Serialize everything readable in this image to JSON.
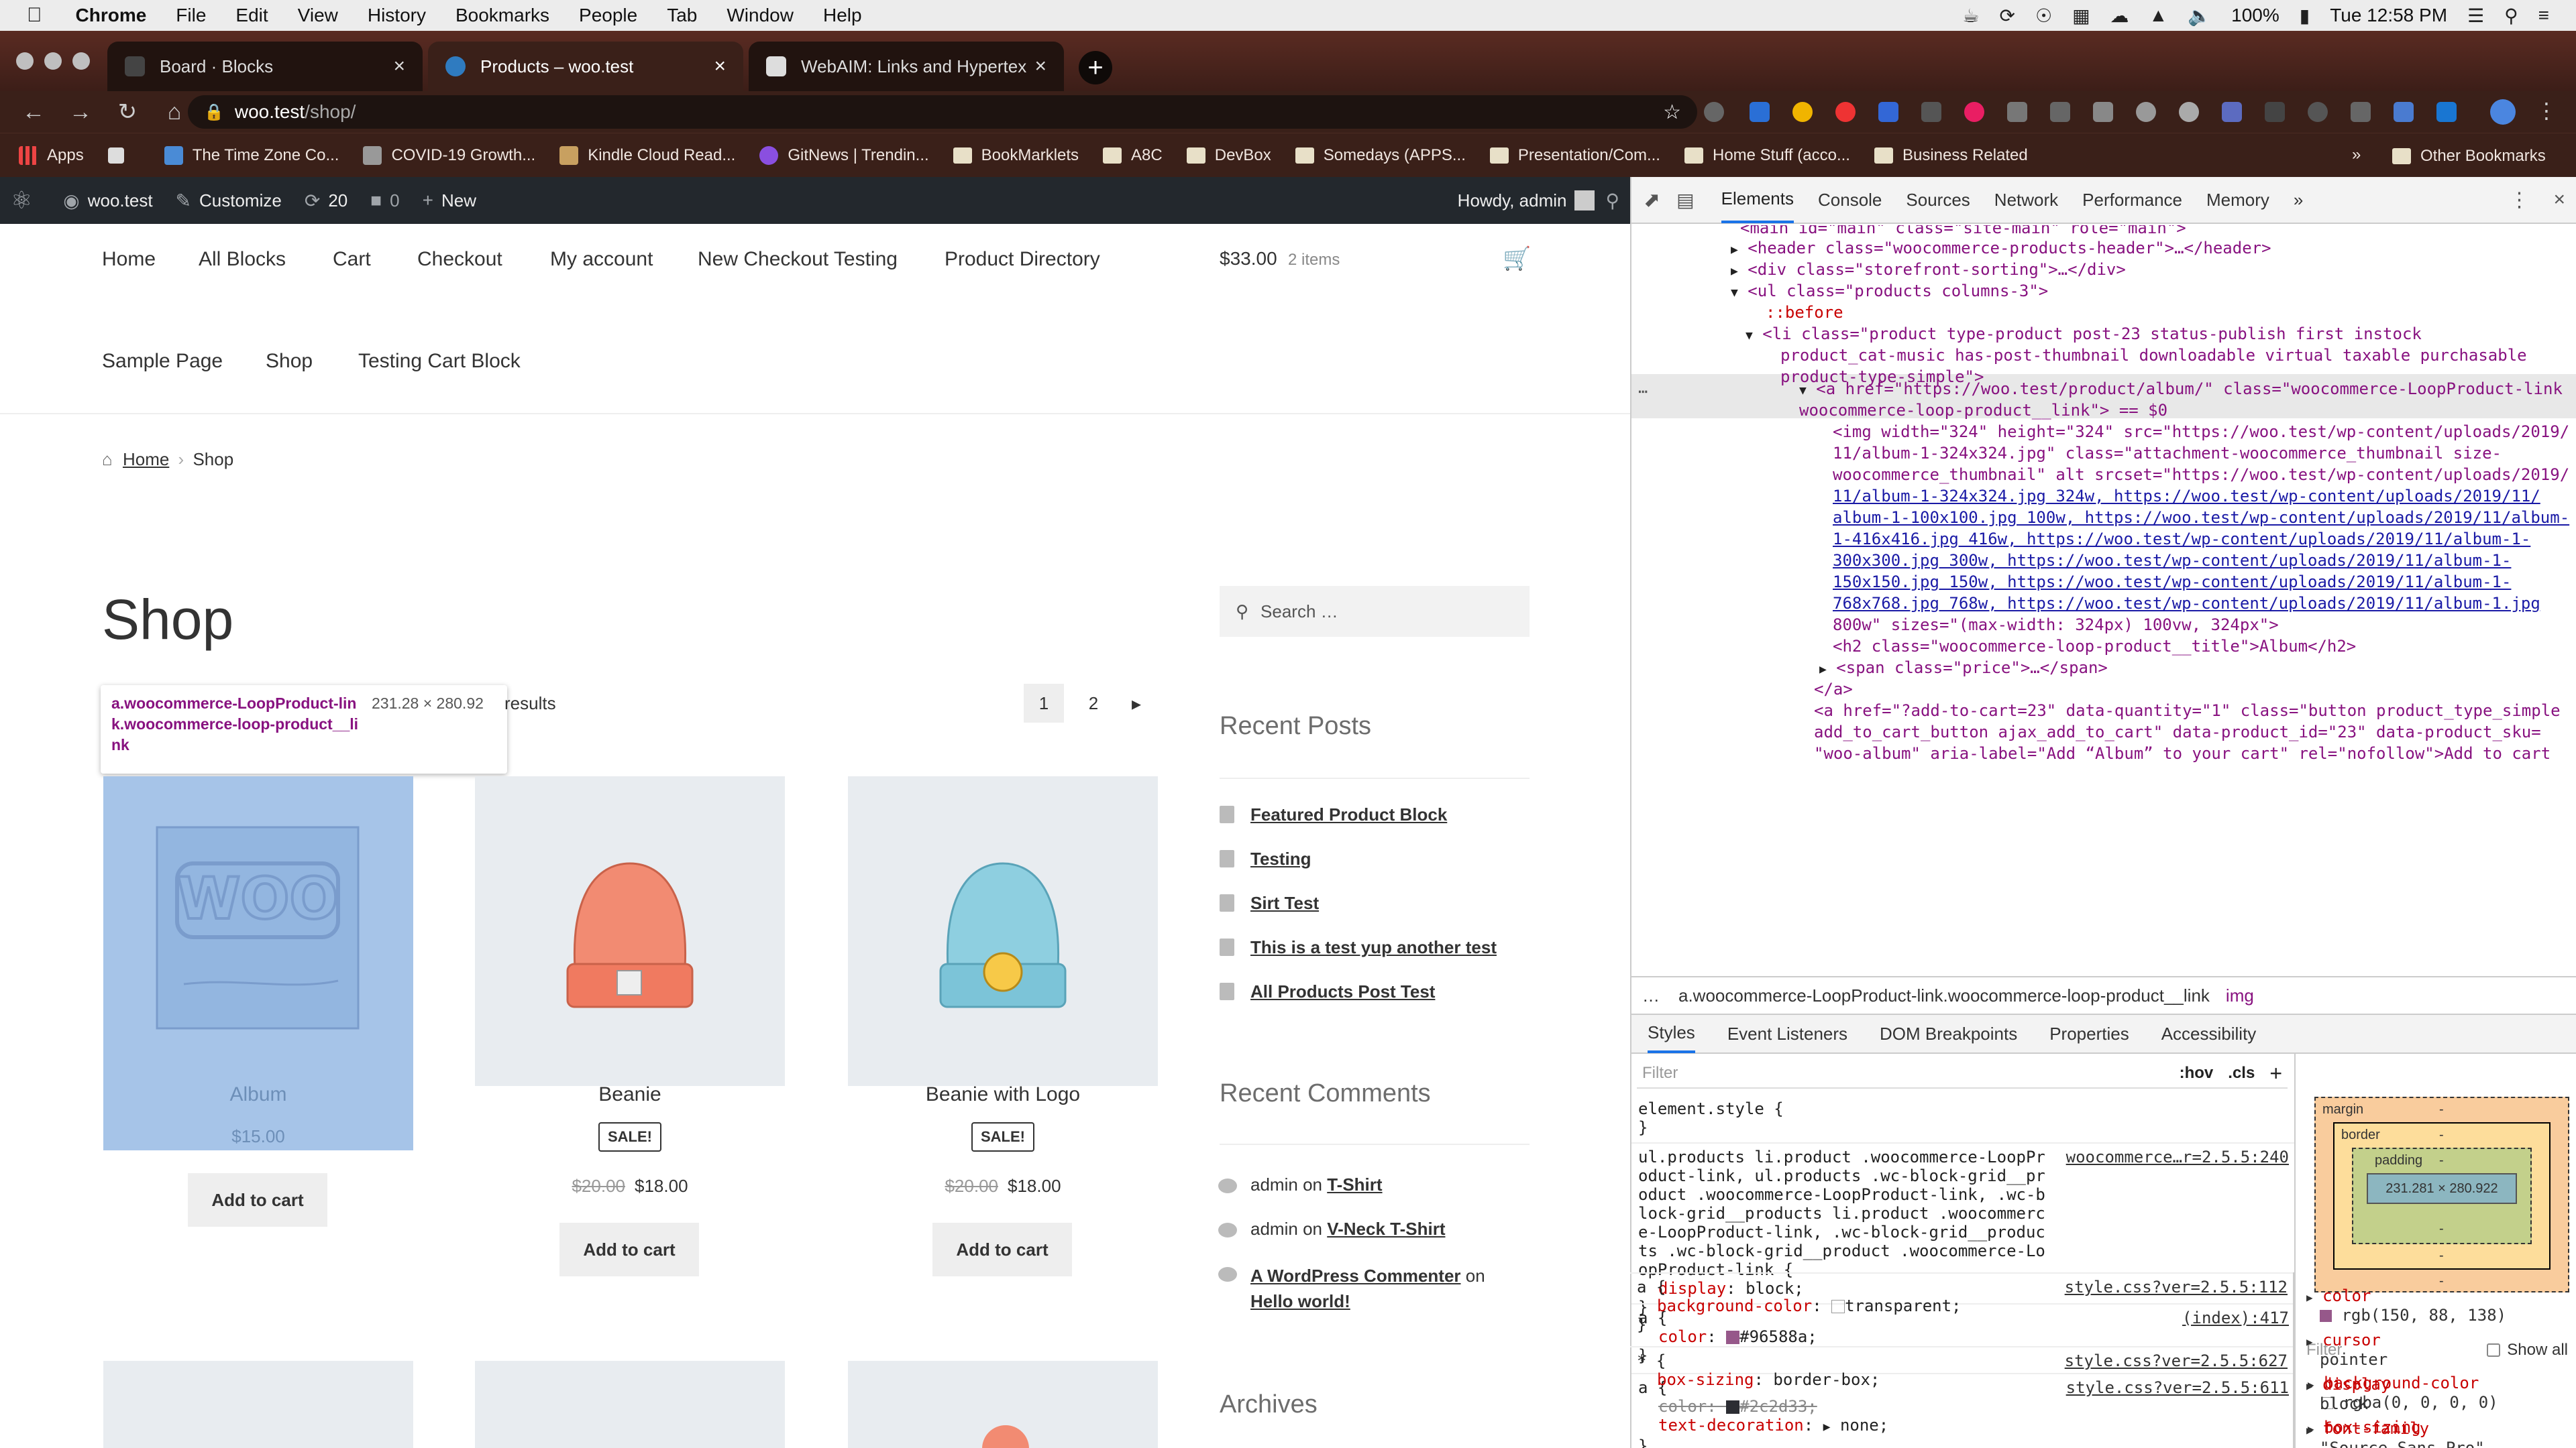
{
  "menubar": {
    "app": "Chrome",
    "items": [
      "File",
      "Edit",
      "View",
      "History",
      "Bookmarks",
      "People",
      "Tab",
      "Window",
      "Help"
    ],
    "battery": "100%",
    "clock": "Tue 12:58 PM"
  },
  "tabs": [
    {
      "title": "Board · Blocks",
      "active": false
    },
    {
      "title": "Products – woo.test",
      "active": true
    },
    {
      "title": "WebAIM: Links and Hypertext",
      "active": false
    }
  ],
  "omnibox": {
    "host": "woo.test",
    "path": "/shop/"
  },
  "bookmarks": [
    "Apps",
    "The Time Zone Co...",
    "COVID-19 Growth...",
    "Kindle Cloud Read...",
    "GitNews | Trendin...",
    "BookMarklets",
    "A8C",
    "DevBox",
    "Somedays (APPS...",
    "Presentation/Com...",
    "Home Stuff (acco...",
    "Business Related"
  ],
  "bookmarks_more": "»",
  "bookmarks_other": "Other Bookmarks",
  "wpadmin": {
    "site": "woo.test",
    "customize": "Customize",
    "updates": "20",
    "comments": "0",
    "new": "New",
    "howdy": "Howdy, admin"
  },
  "nav": {
    "row1": [
      "Home",
      "All Blocks",
      "Cart",
      "Checkout",
      "My account",
      "New Checkout Testing",
      "Product Directory"
    ],
    "row2": [
      "Sample Page",
      "Shop",
      "Testing Cart Block"
    ],
    "cart_total": "$33.00",
    "cart_count": "2 items"
  },
  "breadcrumb": {
    "home": "Home",
    "sep": "›",
    "current": "Shop"
  },
  "page_title": "Shop",
  "results_text": "results",
  "tooltip": {
    "selector": "a.woocommerce-LoopProduct-link.woocommerce-loop-product__link",
    "size": "231.28 × 280.92"
  },
  "pagination": {
    "pages": [
      "1",
      "2"
    ],
    "next": "→"
  },
  "products": [
    {
      "name": "Album",
      "sale": false,
      "price": "$15.00",
      "old_price": "",
      "button": "Add to cart"
    },
    {
      "name": "Beanie",
      "sale": true,
      "sale_label": "SALE!",
      "old_price": "$20.00",
      "price": "$18.00",
      "button": "Add to cart"
    },
    {
      "name": "Beanie with Logo",
      "sale": true,
      "sale_label": "SALE!",
      "old_price": "$20.00",
      "price": "$18.00",
      "button": "Add to cart"
    }
  ],
  "sidebar": {
    "search_placeholder": "Search …",
    "recent_posts_title": "Recent Posts",
    "recent_posts": [
      "Featured Product Block",
      "Testing",
      "Sirt Test",
      "This is a test yup another test",
      "All Products Post Test"
    ],
    "recent_comments_title": "Recent Comments",
    "comments": [
      {
        "author": "admin",
        "on": "on",
        "post": "T-Shirt"
      },
      {
        "author": "admin",
        "on": "on",
        "post": "V-Neck T-Shirt"
      },
      {
        "author": "A WordPress Commenter",
        "on": "on",
        "post": "Hello world!"
      }
    ],
    "archives_title": "Archives"
  },
  "devtools": {
    "tabs": [
      "Elements",
      "Console",
      "Sources",
      "Network",
      "Performance",
      "Memory",
      "»"
    ],
    "dom_lines": [
      "<main id=\"main\" class=\"site-main\" role=\"main\">",
      "<header class=\"woocommerce-products-header\">…</header>",
      "<div class=\"storefront-sorting\">…</div>",
      "<ul class=\"products columns-3\">",
      "::before",
      "<li class=\"product type-product post-23 status-publish first instock",
      "product_cat-music has-post-thumbnail downloadable virtual taxable purchasable",
      "product-type-simple\">",
      "<a href=\"https://woo.test/product/album/\" class=\"woocommerce-LoopProduct-link",
      "woocommerce-loop-product__link\"> == $0",
      "<img width=\"324\" height=\"324\" src=\"https://woo.test/wp-content/uploads/2019/",
      "11/album-1-324x324.jpg\" class=\"attachment-woocommerce_thumbnail size-",
      "woocommerce_thumbnail\" alt srcset=\"https://woo.test/wp-content/uploads/2019/",
      "11/album-1-324x324.jpg 324w, https://woo.test/wp-content/uploads/2019/11/",
      "album-1-100x100.jpg 100w, https://woo.test/wp-content/uploads/2019/11/album-",
      "1-416x416.jpg 416w, https://woo.test/wp-content/uploads/2019/11/album-1-",
      "300x300.jpg 300w, https://woo.test/wp-content/uploads/2019/11/album-1-",
      "150x150.jpg 150w, https://woo.test/wp-content/uploads/2019/11/album-1-",
      "768x768.jpg 768w, https://woo.test/wp-content/uploads/2019/11/album-1.jpg",
      "800w\" sizes=\"(max-width: 324px) 100vw, 324px\">",
      "<h2 class=\"woocommerce-loop-product__title\">Album</h2>",
      "<span class=\"price\">…</span>",
      "</a>",
      "<a href=\"?add-to-cart=23\" data-quantity=\"1\" class=\"button product_type_simple",
      "add_to_cart_button ajax_add_to_cart\" data-product_id=\"23\" data-product_sku=",
      "\"woo-album\" aria-label=\"Add “Album” to your cart\" rel=\"nofollow\">Add to cart"
    ],
    "crumb": [
      "…",
      "a.woocommerce-LoopProduct-link.woocommerce-loop-product__link",
      "img"
    ],
    "subtabs": [
      "Styles",
      "Event Listeners",
      "DOM Breakpoints",
      "Properties",
      "Accessibility"
    ],
    "filter_placeholder": "Filter",
    "hov": ":hov",
    "cls": ".cls",
    "rules": [
      {
        "selector": "element.style {",
        "source": "",
        "decls": [],
        "close": "}"
      },
      {
        "selector": "ul.products li.product .woocommerce-LoopProduct-link, ul.products .wc-block-grid__product .woocommerce-LoopProduct-link, .wc-block-grid__products li.product .woocommerce-LoopProduct-link, .wc-block-grid__products .wc-block-grid__product .woocommerce-LoopProduct-link {",
        "source": "woocommerce…r=2.5.5:240",
        "decls": [
          {
            "p": "display",
            "v": "block;"
          }
        ],
        "close": "}"
      },
      {
        "selector": "a {",
        "source": "(index):417",
        "decls": [
          {
            "p": "color",
            "v": "#96588a;"
          }
        ],
        "close": "}"
      },
      {
        "selector": "a {",
        "source": "style.css?ver=2.5.5:611",
        "decls": [
          {
            "p": "color",
            "v": "#2c2d33;"
          },
          {
            "p": "text-decoration",
            "v": "none;"
          }
        ],
        "close": "}"
      },
      {
        "selector": "a {",
        "source": "style.css?ver=2.5.5:112",
        "decls": [
          {
            "p": "background-color",
            "v": "transparent;"
          }
        ],
        "close": "}"
      },
      {
        "selector": "* {",
        "source": "style.css?ver=2.5.5:627",
        "decls": [
          {
            "p": "box-sizing",
            "v": "border-box;"
          }
        ],
        "close": ""
      }
    ],
    "boxmodel": {
      "margin": "margin",
      "border": "border",
      "padding": "padding",
      "dash": "-",
      "content": "231.281 × 280.922"
    },
    "computed_filter": "Filter",
    "show_all": "Show all",
    "computed": [
      {
        "n": "background-color",
        "v": "rgba(0, 0, 0, 0)"
      },
      {
        "n": "box-sizing",
        "v": "border-box"
      },
      {
        "n": "color",
        "v": "rgb(150, 88, 138)"
      },
      {
        "n": "cursor",
        "v": "pointer"
      },
      {
        "n": "display",
        "v": "block"
      },
      {
        "n": "font-family",
        "v": "\"Source Sans Pro\", Helvetica"
      }
    ]
  },
  "colors": {
    "accent": "#96588a",
    "wpbar": "#23282d",
    "highlight": "#a6c4e8",
    "devtools_select": "#1a73e8"
  }
}
